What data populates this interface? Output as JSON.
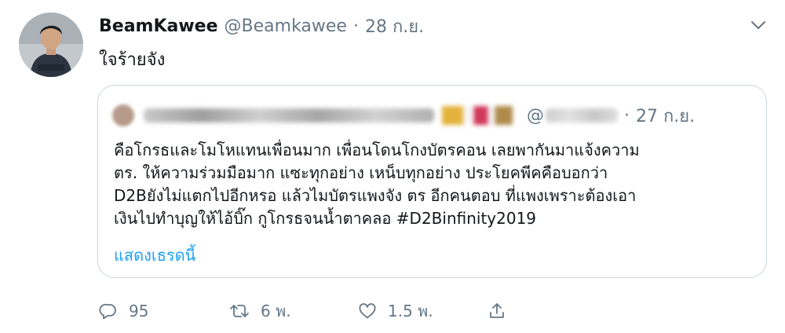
{
  "tweet": {
    "display_name": "BeamKawee",
    "handle": "@Beamkawee",
    "separator": "·",
    "date": "28 ก.ย.",
    "text": "ใจร้ายจัง",
    "more_icon": "chevron-down-icon"
  },
  "quoted": {
    "at_sign": "@",
    "separator": "·",
    "date": "27 ก.ย.",
    "lines": [
      "คือโกรธและโมโหแทนเพื่อนมาก เพื่อนโดนโกงบัตรคอน เลยพากันมาแจ้งความ",
      "ตร. ให้ความร่วมมือมาก แซะทุกอย่าง เหน็บทุกอย่าง ประโยคพีคคือบอกว่า",
      "D2Bยังไม่แตกไปอีกหรอ แล้วไมบัตรแพงจัง ตร อีกคนตอบ ที่แพงเพราะต้องเอา",
      "เงินไปทำบุญให้ไอ้บิ๊ก  กูโกรธจนน้ำตาคลอ #D2Binfinity2019"
    ],
    "show_thread": "แสดงเธรดนี้"
  },
  "actions": {
    "reply_count": "95",
    "retweet_count": "6 พ.",
    "like_count": "1.5 พ.",
    "icons": [
      "reply-icon",
      "retweet-icon",
      "like-icon",
      "share-icon"
    ]
  },
  "colors": {
    "text": "#14171a",
    "secondary": "#657786",
    "link": "#1da1f2",
    "border": "#ccd6dd"
  }
}
